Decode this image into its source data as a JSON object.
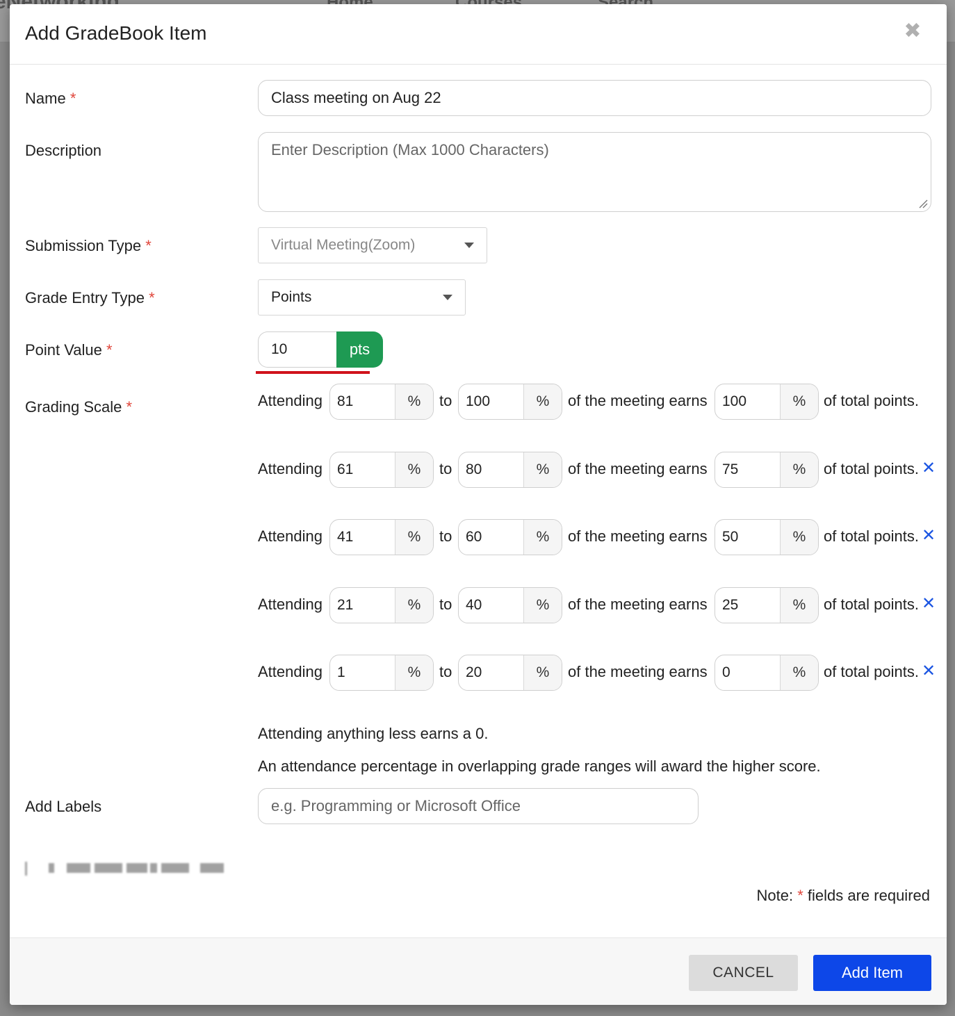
{
  "background": {
    "brand": "eNetworking",
    "nav_links": [
      "Home",
      "Courses",
      "Search"
    ]
  },
  "modal": {
    "title": "Add GradeBook Item",
    "close_icon": "close-icon"
  },
  "form": {
    "name": {
      "label": "Name",
      "value": "Class meeting on Aug 22"
    },
    "description": {
      "label": "Description",
      "placeholder": "Enter Description (Max 1000 Characters)"
    },
    "submission_type": {
      "label": "Submission Type",
      "value": "Virtual Meeting(Zoom)"
    },
    "grade_entry_type": {
      "label": "Grade Entry Type",
      "value": "Points"
    },
    "point_value": {
      "label": "Point Value",
      "value": "10",
      "unit": "pts"
    },
    "grading_scale": {
      "label": "Grading Scale",
      "word_attending": "Attending",
      "word_to": "to",
      "word_earns": "of the meeting earns",
      "word_total": "of total points.",
      "percent_symbol": "%",
      "rows": [
        {
          "from": "81",
          "to": "100",
          "earns": "100",
          "removable": false
        },
        {
          "from": "61",
          "to": "80",
          "earns": "75",
          "removable": true
        },
        {
          "from": "41",
          "to": "60",
          "earns": "50",
          "removable": true
        },
        {
          "from": "21",
          "to": "40",
          "earns": "25",
          "removable": true
        },
        {
          "from": "1",
          "to": "20",
          "earns": "0",
          "removable": true
        }
      ],
      "note_less": "Attending anything less earns a 0.",
      "note_overlap": "An attendance percentage in overlapping grade ranges will award the higher score."
    },
    "labels": {
      "label": "Add Labels",
      "placeholder": "e.g. Programming or Microsoft Office"
    },
    "required_note_prefix": "Note:",
    "required_note_star": "*",
    "required_note_suffix": "fields are required",
    "required_star": "*"
  },
  "footer": {
    "cancel_label": "CANCEL",
    "add_label": "Add Item"
  },
  "colors": {
    "accent_blue": "#0d47e8",
    "pts_green": "#1e9a53",
    "required_red": "#e0453a",
    "remove_blue": "#1b55e2"
  }
}
